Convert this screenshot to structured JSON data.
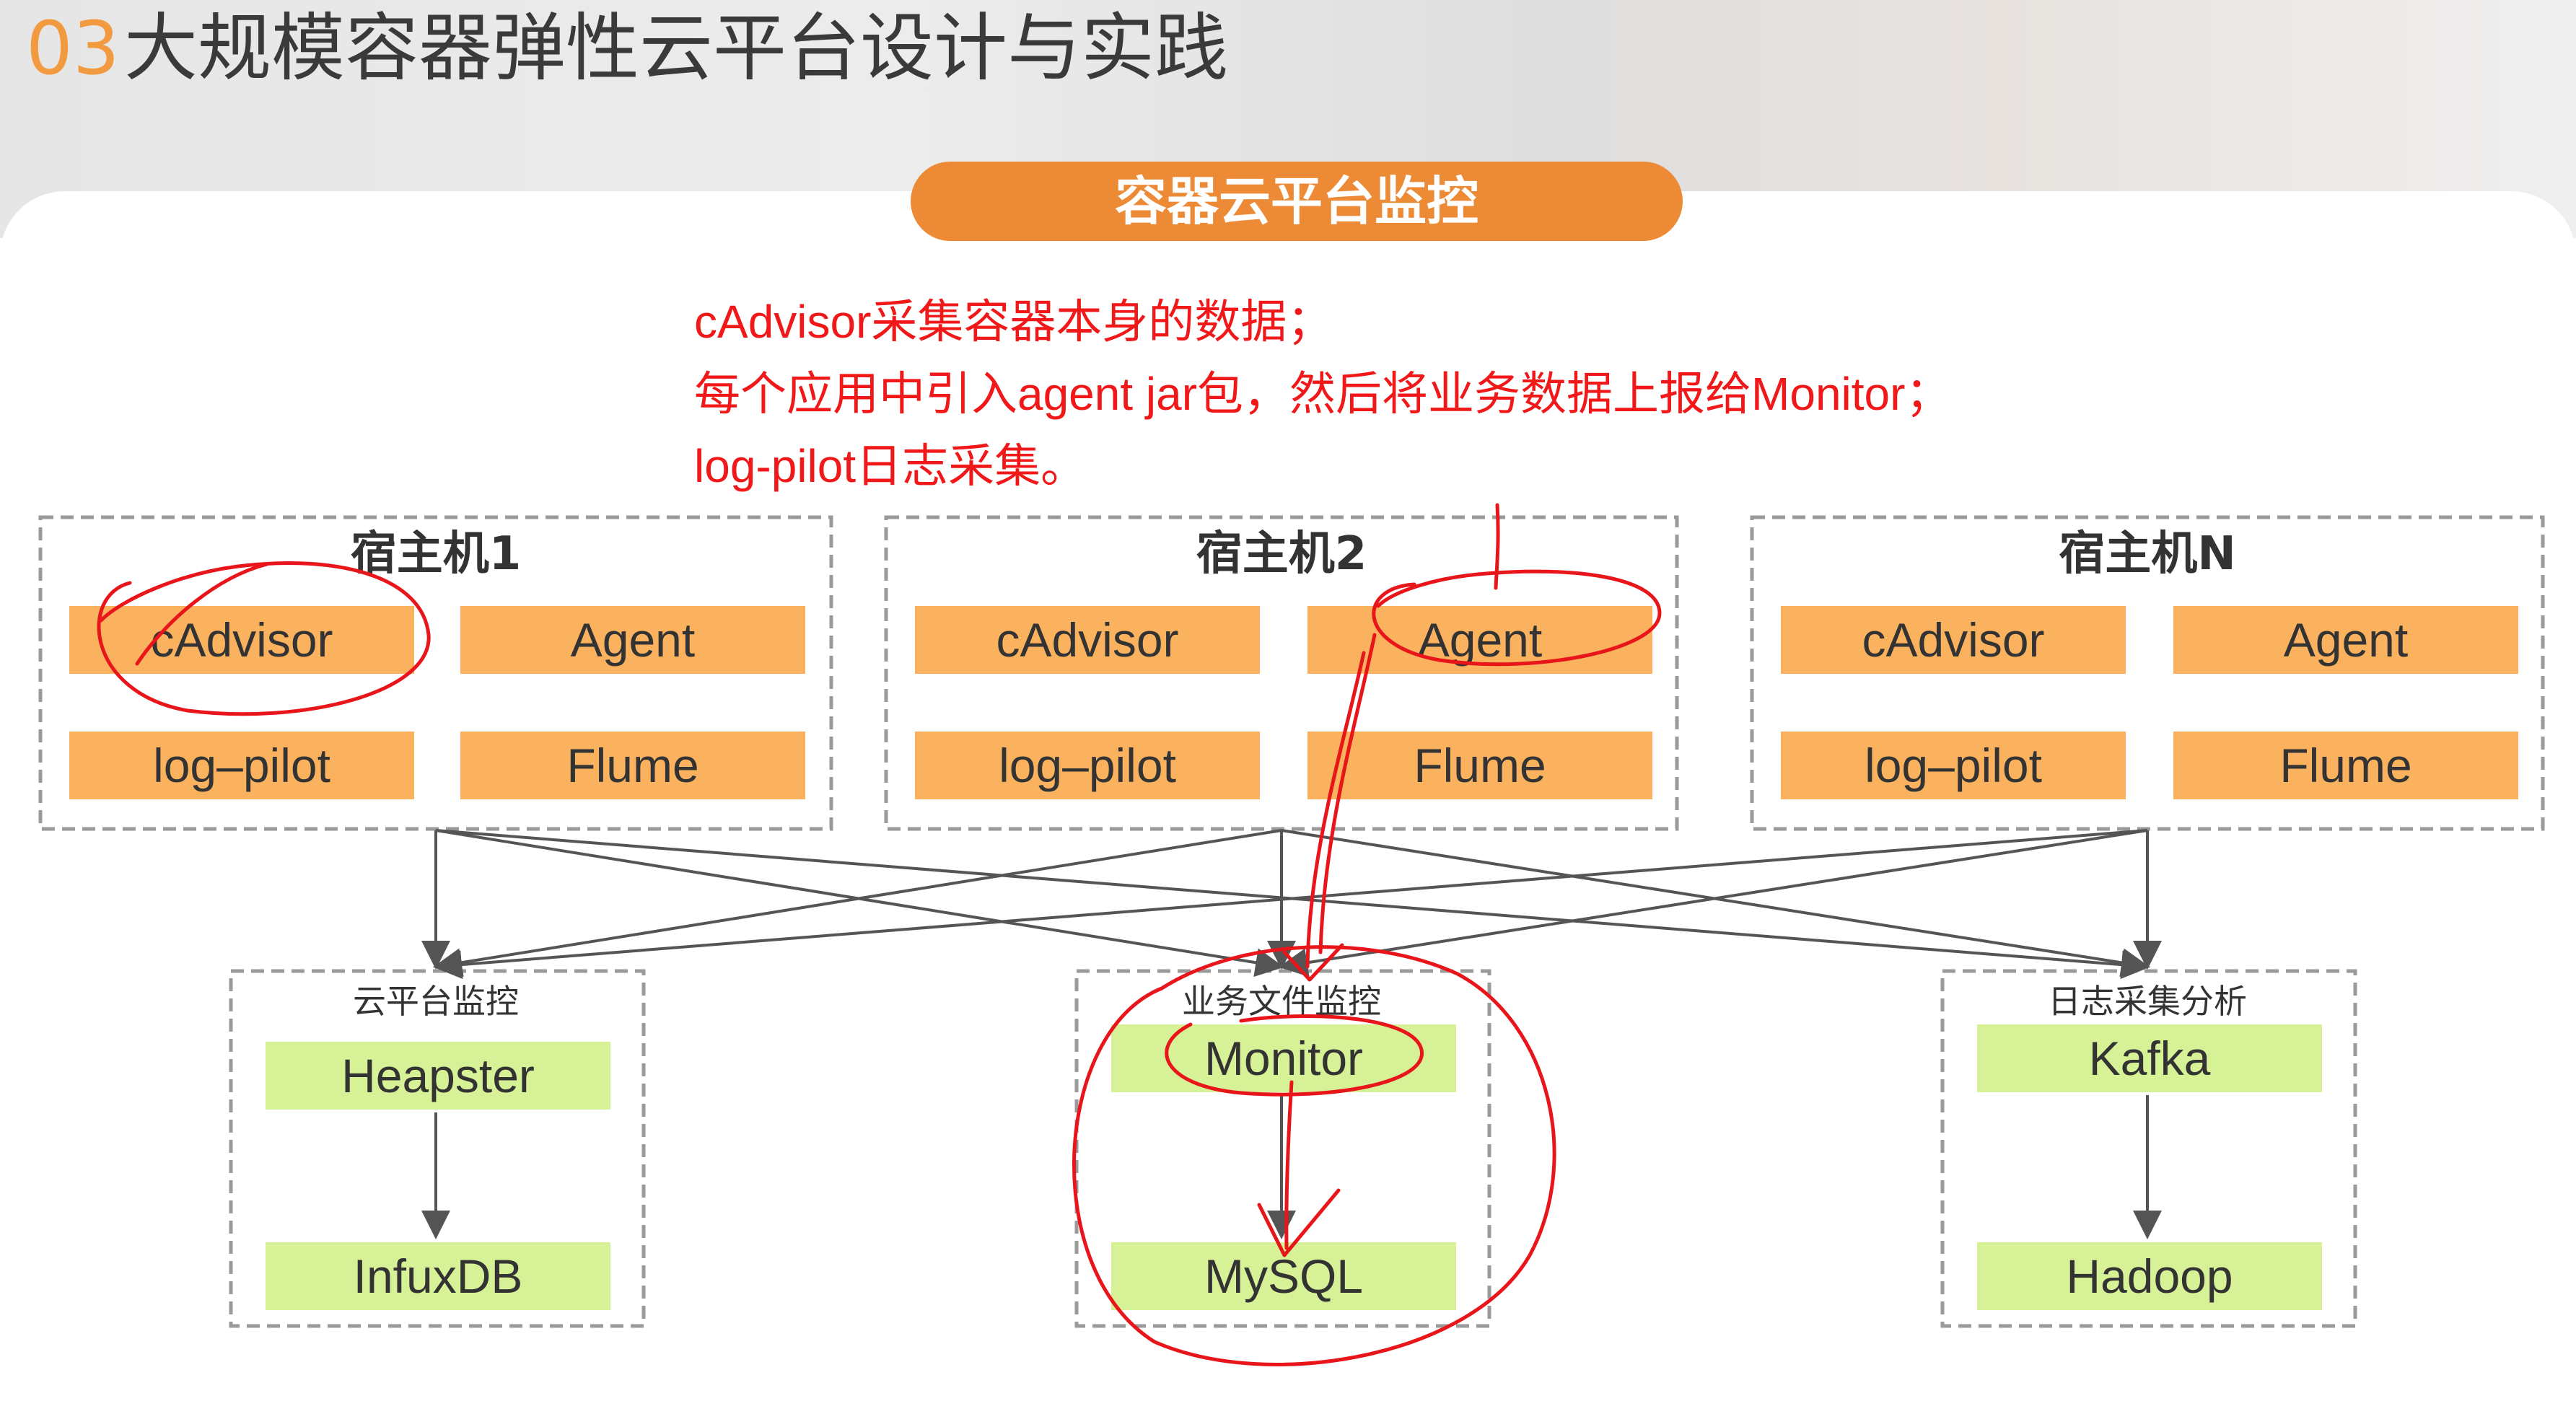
{
  "slide": {
    "number": "03",
    "title": "大规模容器弹性云平台设计与实践",
    "section": "容器云平台监控"
  },
  "note": {
    "lines": [
      "cAdvisor采集容器本身的数据；",
      "每个应用中引入agent jar包，然后将业务数据上报给Monitor；",
      "log-pilot日志采集。"
    ]
  },
  "hosts": [
    {
      "title": "宿主机1",
      "components": [
        "cAdvisor",
        "Agent",
        "log–pilot",
        "Flume"
      ]
    },
    {
      "title": "宿主机2",
      "components": [
        "cAdvisor",
        "Agent",
        "log–pilot",
        "Flume"
      ]
    },
    {
      "title": "宿主机N",
      "components": [
        "cAdvisor",
        "Agent",
        "log–pilot",
        "Flume"
      ]
    }
  ],
  "groups": [
    {
      "title": "云平台监控",
      "top": "Heapster",
      "bottom": "InfuxDB"
    },
    {
      "title": "业务文件监控",
      "top": "Monitor",
      "bottom": "MySQL"
    },
    {
      "title": "日志采集分析",
      "top": "Kafka",
      "bottom": "Hadoop"
    }
  ],
  "colors": {
    "accent_orange": "#ec8a35",
    "component_orange": "#fbb25e",
    "storage_green": "#d7f197",
    "annotation_red": "#f01818"
  }
}
